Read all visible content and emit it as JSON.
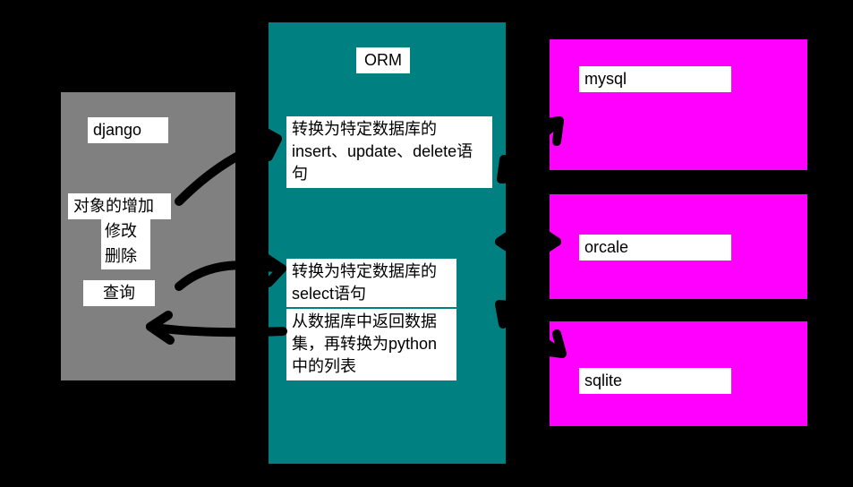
{
  "django": {
    "title": "django",
    "ops": {
      "add": "对象的增加",
      "modify": "修改",
      "delete": "删除"
    },
    "query": "查询"
  },
  "orm": {
    "title": "ORM",
    "iud": "转换为特定数据库的insert、update、delete语句",
    "select": "转换为特定数据库的select语句",
    "result": "从数据库中返回数据集，再转换为python中的列表"
  },
  "db": {
    "mysql": "mysql",
    "oracle": "orcale",
    "sqlite": "sqlite"
  }
}
